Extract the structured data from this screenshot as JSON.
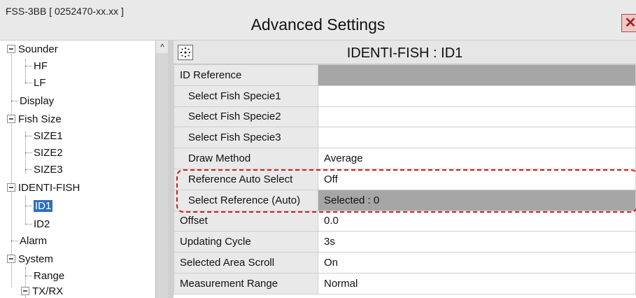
{
  "window": {
    "device_id": "FSS-3BB [ 0252470-xx.xx ]",
    "title": "Advanced Settings",
    "close_glyph": "✕"
  },
  "tree": {
    "sounder": "Sounder",
    "hf": "HF",
    "lf": "LF",
    "display": "Display",
    "fish_size": "Fish Size",
    "size1": "SIZE1",
    "size2": "SIZE2",
    "size3": "SIZE3",
    "identi_fish": "IDENTI-FISH",
    "id1": "ID1",
    "id2": "ID2",
    "alarm": "Alarm",
    "system": "System",
    "range": "Range",
    "txrx": "TX/RX"
  },
  "panel": {
    "title": "IDENTI-FISH : ID1",
    "icon": "fish-sparkle-icon"
  },
  "rows": [
    {
      "label": "ID Reference",
      "value": ""
    },
    {
      "label": "Select Fish Specie1",
      "value": ""
    },
    {
      "label": "Select Fish Specie2",
      "value": ""
    },
    {
      "label": "Select Fish Specie3",
      "value": ""
    },
    {
      "label": "Draw Method",
      "value": "Average"
    },
    {
      "label": "Reference Auto Select",
      "value": "Off"
    },
    {
      "label": "Select Reference (Auto)",
      "value": "Selected : 0"
    },
    {
      "label": "Offset",
      "value": "0.0"
    },
    {
      "label": "Updating Cycle",
      "value": "3s"
    },
    {
      "label": "Selected Area Scroll",
      "value": "On"
    },
    {
      "label": "Measurement Range",
      "value": "Normal"
    }
  ],
  "colors": {
    "selection": "#2f6fc1",
    "highlight_dash": "#d21c1c",
    "disabled_value": "#a6a6a6"
  }
}
